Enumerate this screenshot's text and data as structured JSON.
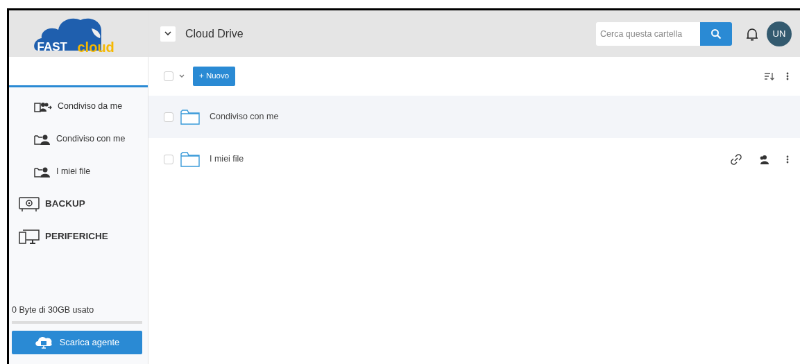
{
  "logo": {
    "word_1": "FAST",
    "word_2": "cloud"
  },
  "header": {
    "title": "Cloud Drive",
    "search": {
      "placeholder": "Cerca questa cartella"
    },
    "avatar": "UN"
  },
  "sidebar": {
    "items": [
      {
        "label": "Condiviso da me",
        "kind": "sub"
      },
      {
        "label": "Condiviso con me",
        "kind": "sub"
      },
      {
        "label": "I miei file",
        "kind": "sub"
      },
      {
        "label": "BACKUP",
        "kind": "main"
      },
      {
        "label": "PERIFERICHE",
        "kind": "main"
      }
    ],
    "storage": {
      "text": "0 Byte di 30GB usato",
      "level": 0
    },
    "download_button": "Scarica agente"
  },
  "toolbar": {
    "select_all": {
      "checked": false
    },
    "new_button": "+ Nuovo"
  },
  "files": [
    {
      "name": "Condiviso con me",
      "checked": false,
      "highlighted": true,
      "show_actions": false
    },
    {
      "name": "I miei file",
      "checked": false,
      "highlighted": false,
      "show_actions": true
    }
  ]
}
